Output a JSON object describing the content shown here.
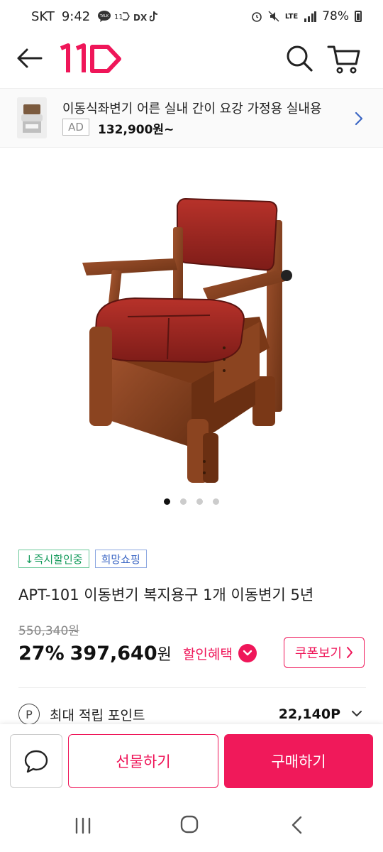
{
  "status_bar": {
    "carrier": "SKT",
    "time": "9:42",
    "notif_icons": [
      "talk-icon",
      "11st-icon",
      "dx-icon",
      "tiktok-icon"
    ],
    "lte": "LTE",
    "battery": "78%"
  },
  "header": {
    "logo_text": "11",
    "logo_color": "#ef1659"
  },
  "ad_banner": {
    "title": "이동식좌변기 어른 실내 간이 요강 가정용 실내용",
    "badge": "AD",
    "price": "132,900원~"
  },
  "gallery": {
    "image_label": "product-chair-image",
    "page_count": 4,
    "active_index": 0
  },
  "tags": {
    "instant_discount": "↓즉시할인중",
    "hope_shopping": "희망쇼핑"
  },
  "product": {
    "title": "APT-101 이동변기 복지용구 1개 이동변기 5년",
    "original_price": "550,340원",
    "discount_rate": "27%",
    "price": "397,640",
    "price_unit": "원",
    "benefit_label": "할인혜택",
    "coupon_label": "쿠폰보기"
  },
  "points": {
    "icon_label": "P",
    "label": "최대 적립 포인트",
    "value": "22,140P"
  },
  "actions": {
    "gift_label": "선물하기",
    "buy_label": "구매하기"
  },
  "colors": {
    "brand": "#ef1659",
    "tag_green": "#129a5a",
    "tag_blue": "#3b66c4"
  }
}
